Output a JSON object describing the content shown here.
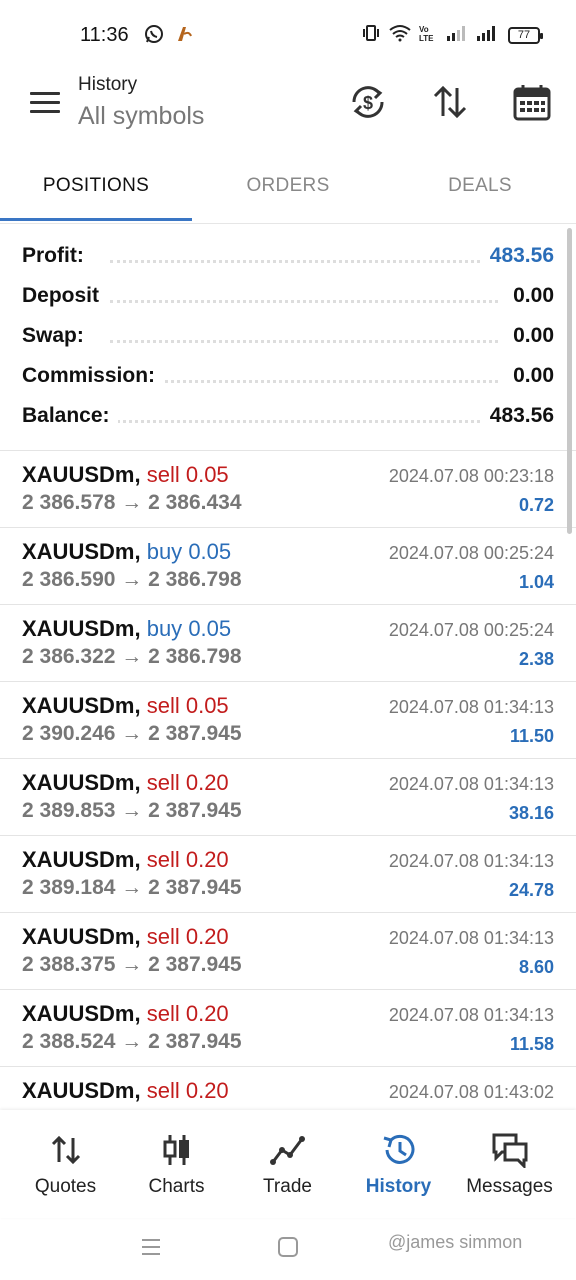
{
  "status": {
    "time": "11:36",
    "battery": "77"
  },
  "header": {
    "subtitle": "History",
    "title": "All symbols",
    "icons": [
      "currency-exchange-icon",
      "sort-icon",
      "calendar-icon"
    ]
  },
  "tabs": [
    {
      "label": "POSITIONS",
      "active": true
    },
    {
      "label": "ORDERS",
      "active": false
    },
    {
      "label": "DEALS",
      "active": false
    }
  ],
  "summary": [
    {
      "label": "Profit:",
      "value": "483.56",
      "highlight": true
    },
    {
      "label": "Deposit",
      "value": "0.00",
      "highlight": false
    },
    {
      "label": "Swap:",
      "value": "0.00",
      "highlight": false
    },
    {
      "label": "Commission:",
      "value": "0.00",
      "highlight": false
    },
    {
      "label": "Balance:",
      "value": "483.56",
      "highlight": false
    }
  ],
  "positions": [
    {
      "symbol": "XAUUSDm,",
      "side": "sell",
      "volume": "0.05",
      "prices": "2 386.578 → 2 386.434",
      "datetime": "2024.07.08 00:23:18",
      "profit": "0.72"
    },
    {
      "symbol": "XAUUSDm,",
      "side": "buy",
      "volume": "0.05",
      "prices": "2 386.590 → 2 386.798",
      "datetime": "2024.07.08 00:25:24",
      "profit": "1.04"
    },
    {
      "symbol": "XAUUSDm,",
      "side": "buy",
      "volume": "0.05",
      "prices": "2 386.322 → 2 386.798",
      "datetime": "2024.07.08 00:25:24",
      "profit": "2.38"
    },
    {
      "symbol": "XAUUSDm,",
      "side": "sell",
      "volume": "0.05",
      "prices": "2 390.246 → 2 387.945",
      "datetime": "2024.07.08 01:34:13",
      "profit": "11.50"
    },
    {
      "symbol": "XAUUSDm,",
      "side": "sell",
      "volume": "0.20",
      "prices": "2 389.853 → 2 387.945",
      "datetime": "2024.07.08 01:34:13",
      "profit": "38.16"
    },
    {
      "symbol": "XAUUSDm,",
      "side": "sell",
      "volume": "0.20",
      "prices": "2 389.184 → 2 387.945",
      "datetime": "2024.07.08 01:34:13",
      "profit": "24.78"
    },
    {
      "symbol": "XAUUSDm,",
      "side": "sell",
      "volume": "0.20",
      "prices": "2 388.375 → 2 387.945",
      "datetime": "2024.07.08 01:34:13",
      "profit": "8.60"
    },
    {
      "symbol": "XAUUSDm,",
      "side": "sell",
      "volume": "0.20",
      "prices": "2 388.524 → 2 387.945",
      "datetime": "2024.07.08 01:34:13",
      "profit": "11.58"
    },
    {
      "symbol": "XAUUSDm,",
      "side": "sell",
      "volume": "0.20",
      "prices": "",
      "datetime": "2024.07.08 01:43:02",
      "profit": ""
    }
  ],
  "bottom_nav": [
    {
      "label": "Quotes",
      "icon": "quotes-icon",
      "active": false
    },
    {
      "label": "Charts",
      "icon": "candlestick-icon",
      "active": false
    },
    {
      "label": "Trade",
      "icon": "trade-line-icon",
      "active": false
    },
    {
      "label": "History",
      "icon": "history-icon",
      "active": true
    },
    {
      "label": "Messages",
      "icon": "messages-icon",
      "active": false
    }
  ],
  "watermark": "@james simmon",
  "colors": {
    "accent": "#2a6db8",
    "sell": "#c21c1c",
    "buy": "#2a6db8",
    "tab_indicator": "#3a76c4"
  }
}
